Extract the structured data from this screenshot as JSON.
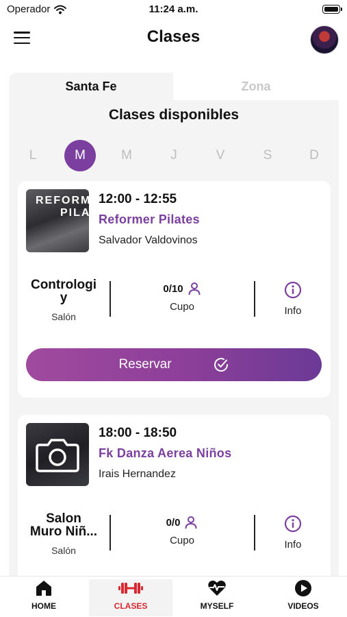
{
  "status_bar": {
    "carrier": "Operador",
    "time": "11:24 a.m."
  },
  "header": {
    "title": "Clases"
  },
  "tabs": [
    {
      "label": "Santa Fe",
      "active": true
    },
    {
      "label": "Zona",
      "active": false
    }
  ],
  "section_title": "Clases disponibles",
  "days": [
    {
      "label": "L",
      "active": false
    },
    {
      "label": "M",
      "active": true
    },
    {
      "label": "M",
      "active": false
    },
    {
      "label": "J",
      "active": false
    },
    {
      "label": "V",
      "active": false
    },
    {
      "label": "S",
      "active": false
    },
    {
      "label": "D",
      "active": false
    }
  ],
  "classes": [
    {
      "thumbnail_text": [
        "REFORM",
        "PILAT"
      ],
      "time": "12:00 - 12:55",
      "name": "Reformer Pilates",
      "coach": "Salvador Valdovinos",
      "room_lines": [
        "Contrologi",
        "y"
      ],
      "room_label": "Salón",
      "cupo": "0/10",
      "cupo_label": "Cupo",
      "info_label": "Info",
      "reserve_label": "Reservar"
    },
    {
      "time": "18:00 - 18:50",
      "name": "Fk Danza Aerea Niños",
      "coach": "Irais Hernandez",
      "room_lines": [
        "Salon",
        "Muro Niñ..."
      ],
      "room_label": "Salón",
      "cupo": "0/0",
      "cupo_label": "Cupo",
      "info_label": "Info"
    }
  ],
  "bottom_nav": [
    {
      "label": "HOME",
      "icon": "home-icon",
      "active": false
    },
    {
      "label": "CLASES",
      "icon": "dumbbell-icon",
      "active": true
    },
    {
      "label": "MYSELF",
      "icon": "heart-pulse-icon",
      "active": false
    },
    {
      "label": "VIDEOS",
      "icon": "play-icon",
      "active": false
    }
  ],
  "colors": {
    "accent": "#7b3fa0",
    "nav_active": "#d9262f",
    "gradient_start": "#a04a9e",
    "gradient_end": "#6b3a96"
  }
}
